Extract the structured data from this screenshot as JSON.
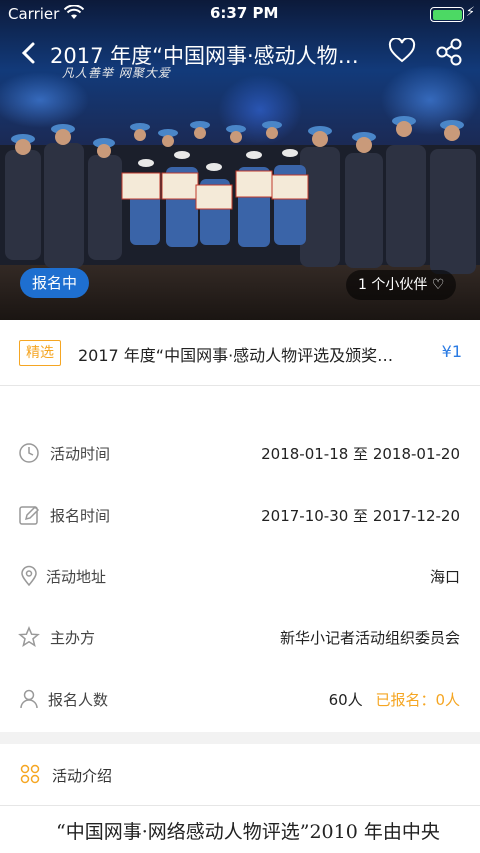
{
  "status_bar": {
    "carrier": "Carrier",
    "time": "6:37 PM"
  },
  "nav": {
    "title": "2017 年度“中国网事·感动人物评选及颁奖…"
  },
  "hero": {
    "banner": "凡人善举  网聚大爱",
    "status_badge": "报名中",
    "companions": "1 个小伙伴"
  },
  "event": {
    "tag": "精选",
    "name": "2017 年度“中国网事·感动人物评选及颁奖…",
    "price": "¥1"
  },
  "info": [
    {
      "icon": "clock-icon",
      "label": "活动时间",
      "value": "2018-01-18 至 2018-01-20"
    },
    {
      "icon": "edit-icon",
      "label": "报名时间",
      "value": "2017-10-30 至 2017-12-20"
    },
    {
      "icon": "location-icon",
      "label": "活动地址",
      "value": "海口"
    },
    {
      "icon": "star-icon",
      "label": "主办方",
      "value": "新华小记者活动组织委员会"
    },
    {
      "icon": "person-icon",
      "label": "报名人数",
      "value": "60人",
      "sub": "已报名：0人"
    }
  ],
  "intro": {
    "title": "活动介绍",
    "body": "“中国网事·网络感动人物评选”2010 年由中央"
  },
  "colors": {
    "accent": "#f5a623",
    "blue": "#1e6fd0",
    "price": "#2b7be3"
  }
}
